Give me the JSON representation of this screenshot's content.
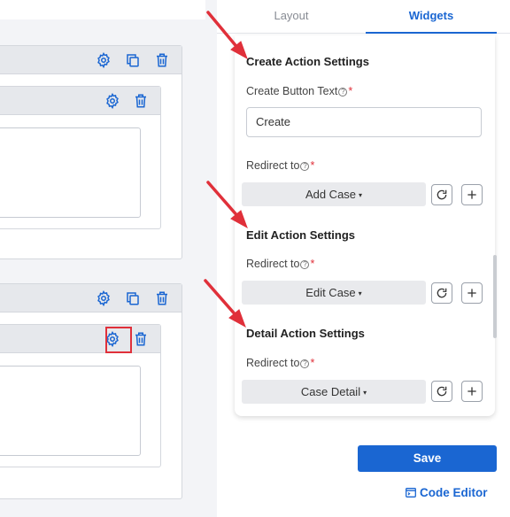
{
  "tabs": [
    {
      "label": "Layout",
      "active": false
    },
    {
      "label": "Widgets",
      "active": true
    }
  ],
  "create_section": {
    "title": "Create Action Settings",
    "button_text_label": "Create Button Text",
    "button_text_value": "Create",
    "redirect_label": "Redirect to",
    "redirect_value": "Add Case"
  },
  "edit_section": {
    "title": "Edit Action Settings",
    "redirect_label": "Redirect to",
    "redirect_value": "Edit Case"
  },
  "detail_section": {
    "title": "Detail Action Settings",
    "redirect_label": "Redirect to",
    "redirect_value": "Case Detail"
  },
  "help_glyph": "?",
  "required_mark": "*",
  "caret_glyph": "▾",
  "footer": {
    "save_label": "Save",
    "code_editor_label": "Code Editor"
  },
  "icons": {
    "settings": "gear-icon",
    "copy": "copy-icon",
    "delete": "trash-icon",
    "refresh": "refresh-icon",
    "add": "plus-icon",
    "code_editor": "code-editor-icon"
  },
  "colors": {
    "accent": "#1a66d2",
    "annotation": "#e0303a",
    "required": "#e0303a"
  }
}
